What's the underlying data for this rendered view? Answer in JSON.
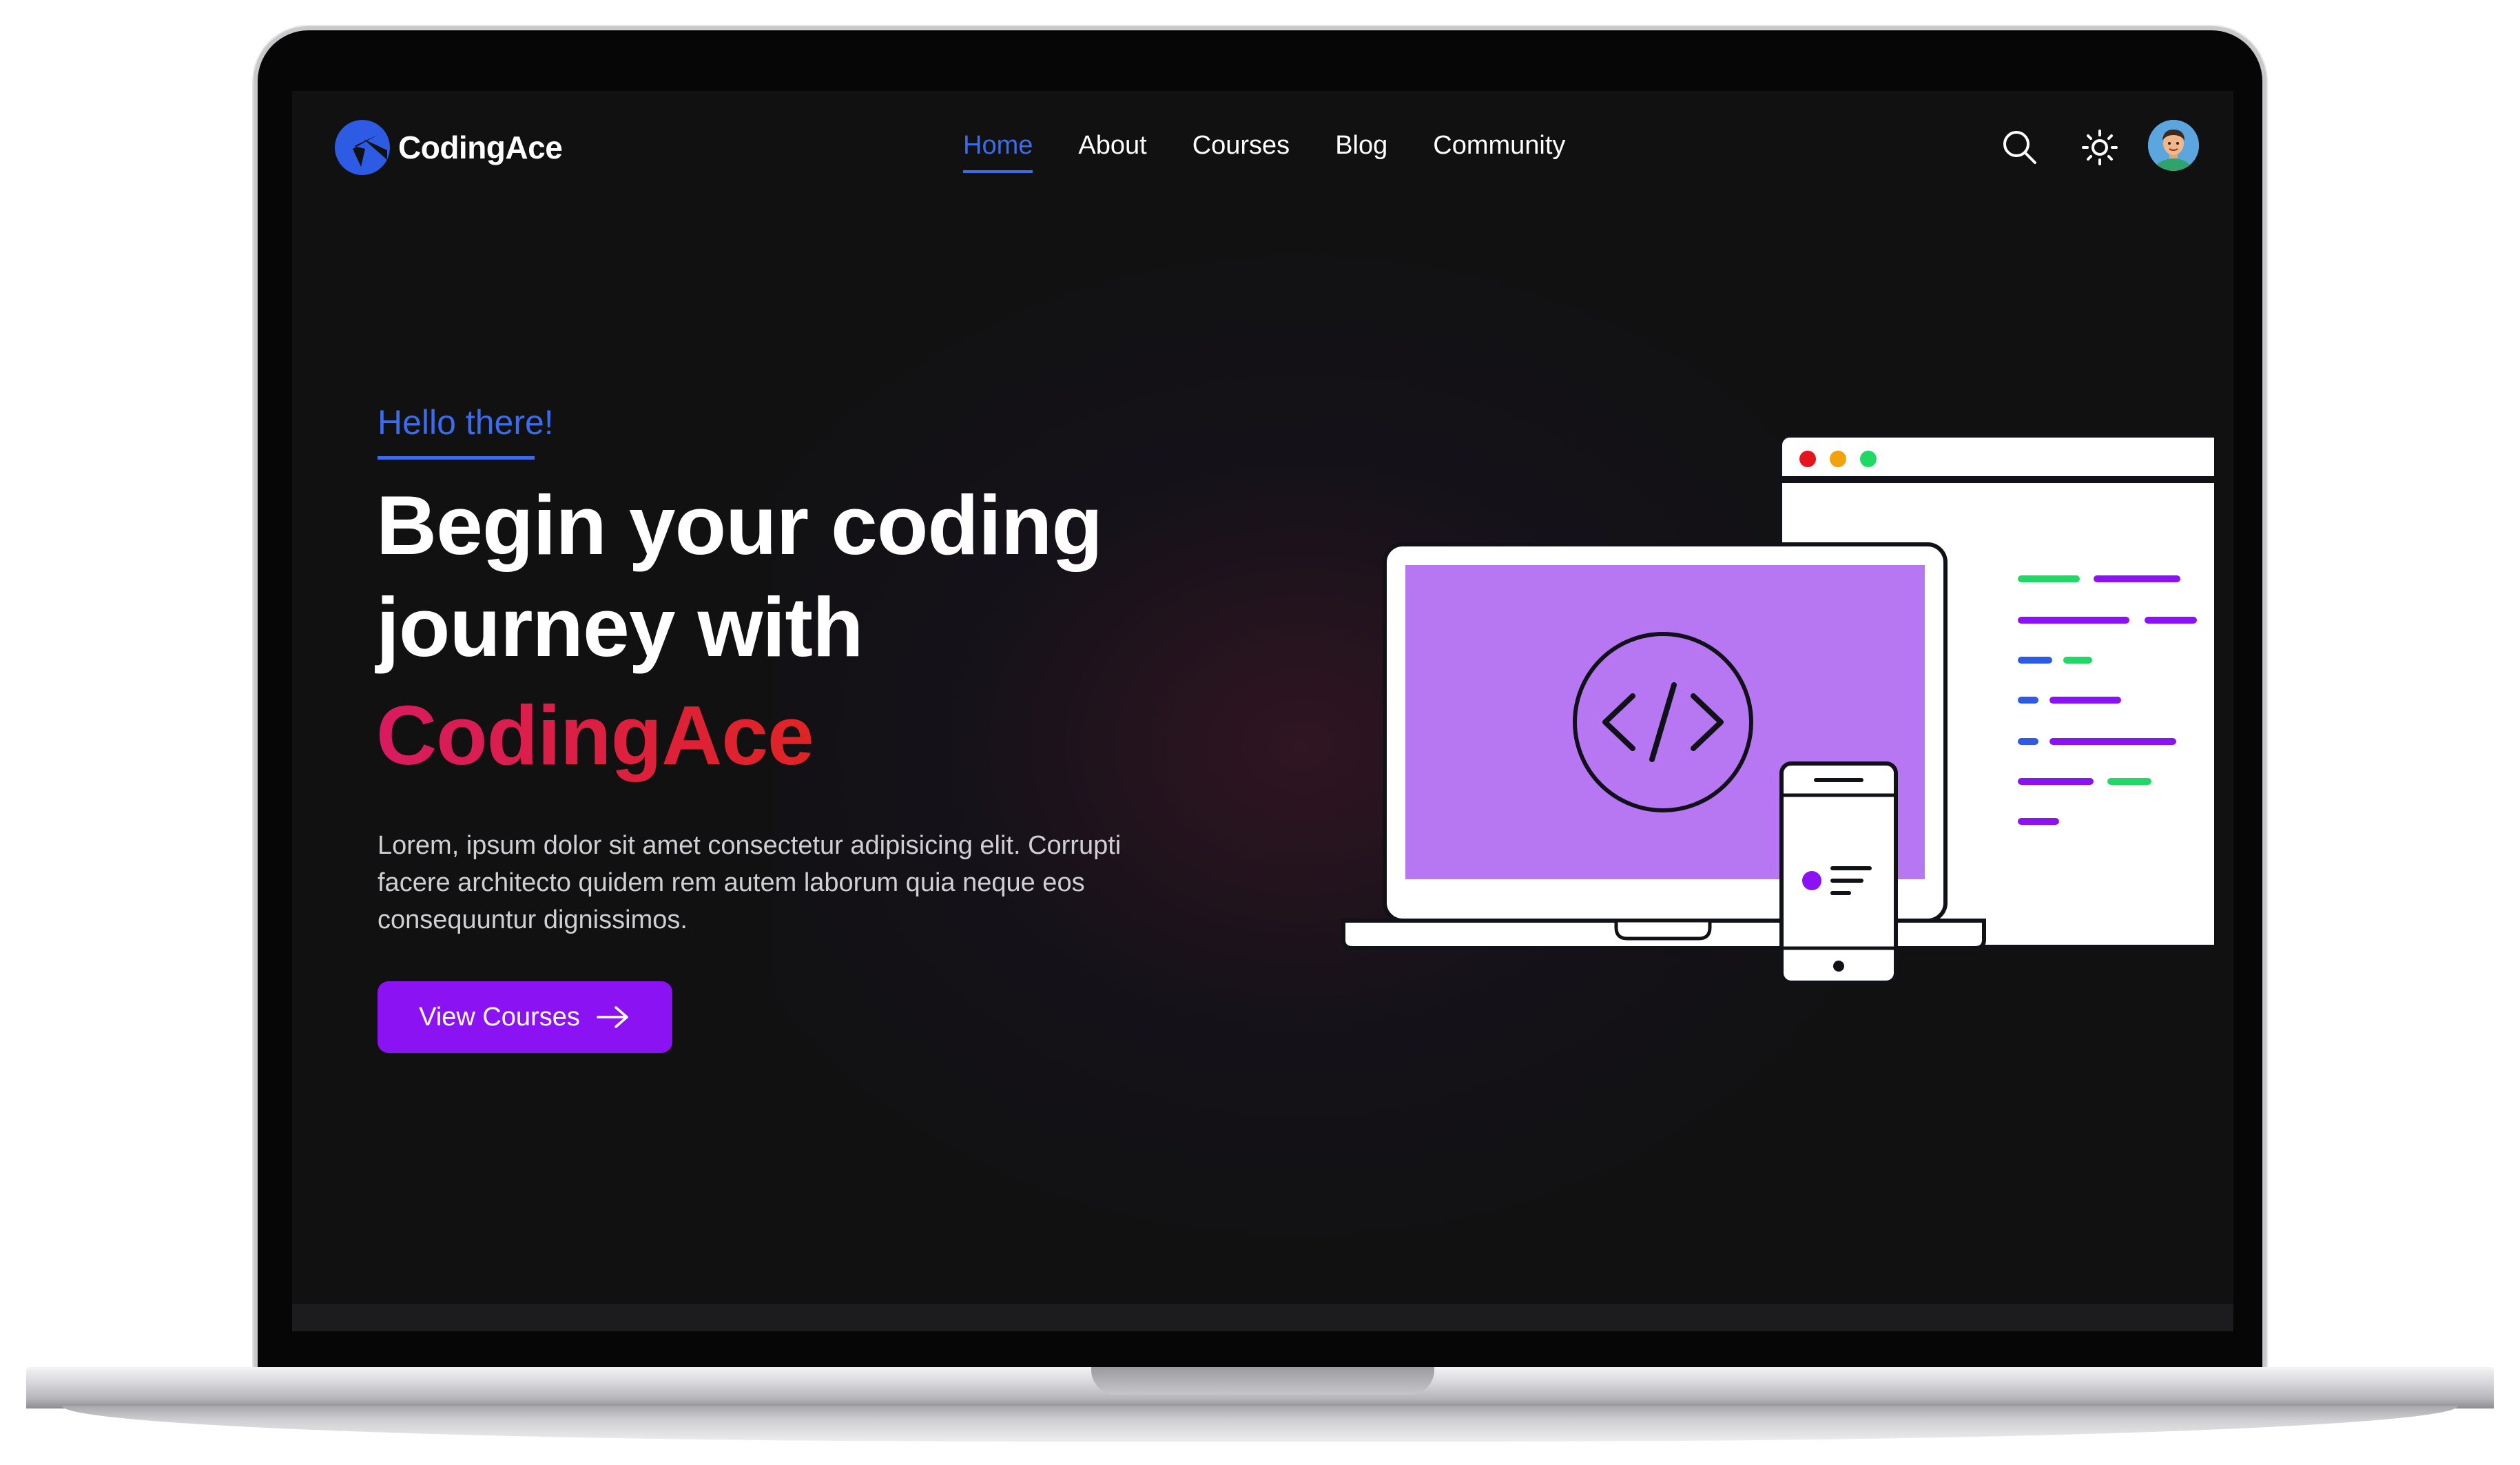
{
  "brand": {
    "name": "CodingAce",
    "logo_icon": "codingace-logo-icon",
    "color": "#2d5be3"
  },
  "nav": {
    "items": [
      {
        "label": "Home",
        "active": true
      },
      {
        "label": "About",
        "active": false
      },
      {
        "label": "Courses",
        "active": false
      },
      {
        "label": "Blog",
        "active": false
      },
      {
        "label": "Community",
        "active": false
      }
    ],
    "icons": [
      "search-icon",
      "sun-theme-icon",
      "user-avatar"
    ]
  },
  "hero": {
    "greeting": "Hello there!",
    "headline_line1": "Begin your coding",
    "headline_line2": "journey with",
    "headline_brand": "CodingAce",
    "description": "Lorem, ipsum dolor sit amet consectetur adipisicing elit. Corrupti facere architecto quidem rem autem laborum quia neque eos consequuntur dignissimos.",
    "cta_label": "View Courses",
    "cta_icon": "arrow-right-icon"
  },
  "colors": {
    "accent_blue": "#3b6cf0",
    "cta_purple": "#8b12f2",
    "brand_gradient_start": "#d81b60",
    "brand_gradient_end": "#e02424",
    "background": "#111112",
    "illustration_screen": "#b777f2"
  }
}
